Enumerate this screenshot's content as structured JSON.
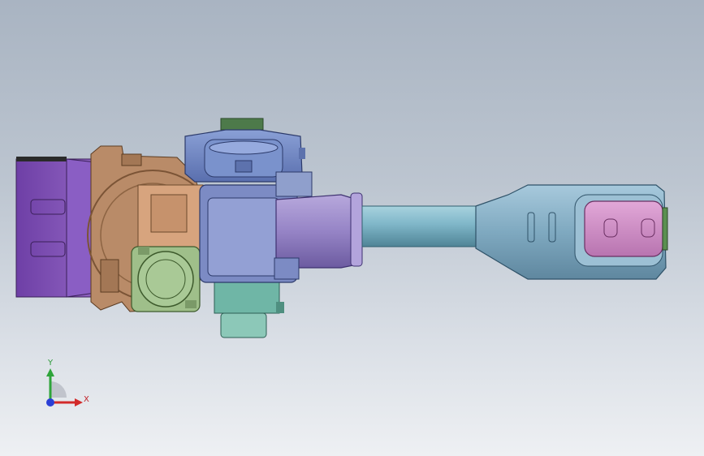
{
  "view": {
    "background_top": "#a9b4c2",
    "background_bottom": "#eef0f3"
  },
  "triad": {
    "x_label": "X",
    "y_label": "Y",
    "x_color": "#d22a2a",
    "y_color": "#2ea43a",
    "z_color": "#2b3fd6"
  },
  "parts": [
    {
      "name": "purple-motor-housing",
      "color": "#7d4fb0"
    },
    {
      "name": "copper-base-casing",
      "color": "#b98b68"
    },
    {
      "name": "green-motor-cap",
      "color": "#9fbf8a"
    },
    {
      "name": "blue-gearbox",
      "color": "#6f86c4"
    },
    {
      "name": "teal-connector",
      "color": "#6fb6a6"
    },
    {
      "name": "violet-arm-joint",
      "color": "#9a86c6"
    },
    {
      "name": "cyan-forearm-tube",
      "color": "#7ab6c6"
    },
    {
      "name": "pink-wrist-unit",
      "color": "#cf8fc6"
    }
  ]
}
